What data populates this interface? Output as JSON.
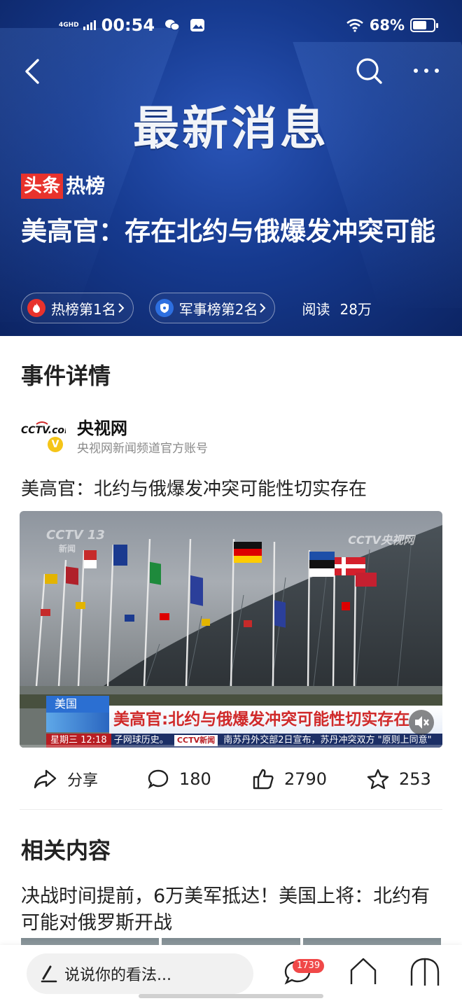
{
  "status_bar": {
    "network": "4GHD",
    "time": "00:54",
    "battery": "68%",
    "battery_level": 0.68
  },
  "header": {
    "banner_title": "最新消息",
    "brand_red": "头条",
    "brand_label": "热榜",
    "headline": "美高官：存在北约与俄爆发冲突可能",
    "rank_pills": [
      {
        "label": "热榜第1名",
        "icon": "fire-icon"
      },
      {
        "label": "军事榜第2名",
        "icon": "shield-icon"
      }
    ],
    "reads_label": "阅读",
    "reads_value": "28万"
  },
  "event": {
    "section_title": "事件详情",
    "source_logo_text": "CCTV.com",
    "source_name": "央视网",
    "source_desc": "央视网新闻频道官方账号",
    "verified_mark": "V",
    "article_title": "美高官：北约与俄爆发冲突可能性切实存在",
    "video": {
      "watermark_channel": "CCTV 13",
      "watermark_sub": "新闻",
      "watermark_site": "CCTV央视网",
      "region_label": "美国",
      "caption": "美高官:北约与俄爆发冲突可能性切实存在",
      "ticker_day": "星期三",
      "ticker_time": "12:18",
      "ticker_text_1": "子网球历史。",
      "ticker_logo": "CCTV新闻",
      "ticker_text_2": "南苏丹外交部2日宣布，苏丹冲突双方 \"原则上同意\"",
      "progress": 0.0
    }
  },
  "actions": {
    "share_label": "分享",
    "comment_count": "180",
    "like_count": "2790",
    "favorite_count": "253"
  },
  "related": {
    "section_title": "相关内容",
    "items": [
      {
        "title": "决战时间提前，6万美军抵达！美国上将：北约有可能对俄罗斯开战"
      }
    ]
  },
  "bottom_bar": {
    "comment_placeholder": "说说你的看法...",
    "comment_badge": "1739"
  },
  "colors": {
    "brand_red": "#e8322c",
    "hero_blue": "#163a8f",
    "caption_red": "#d02a2a"
  }
}
